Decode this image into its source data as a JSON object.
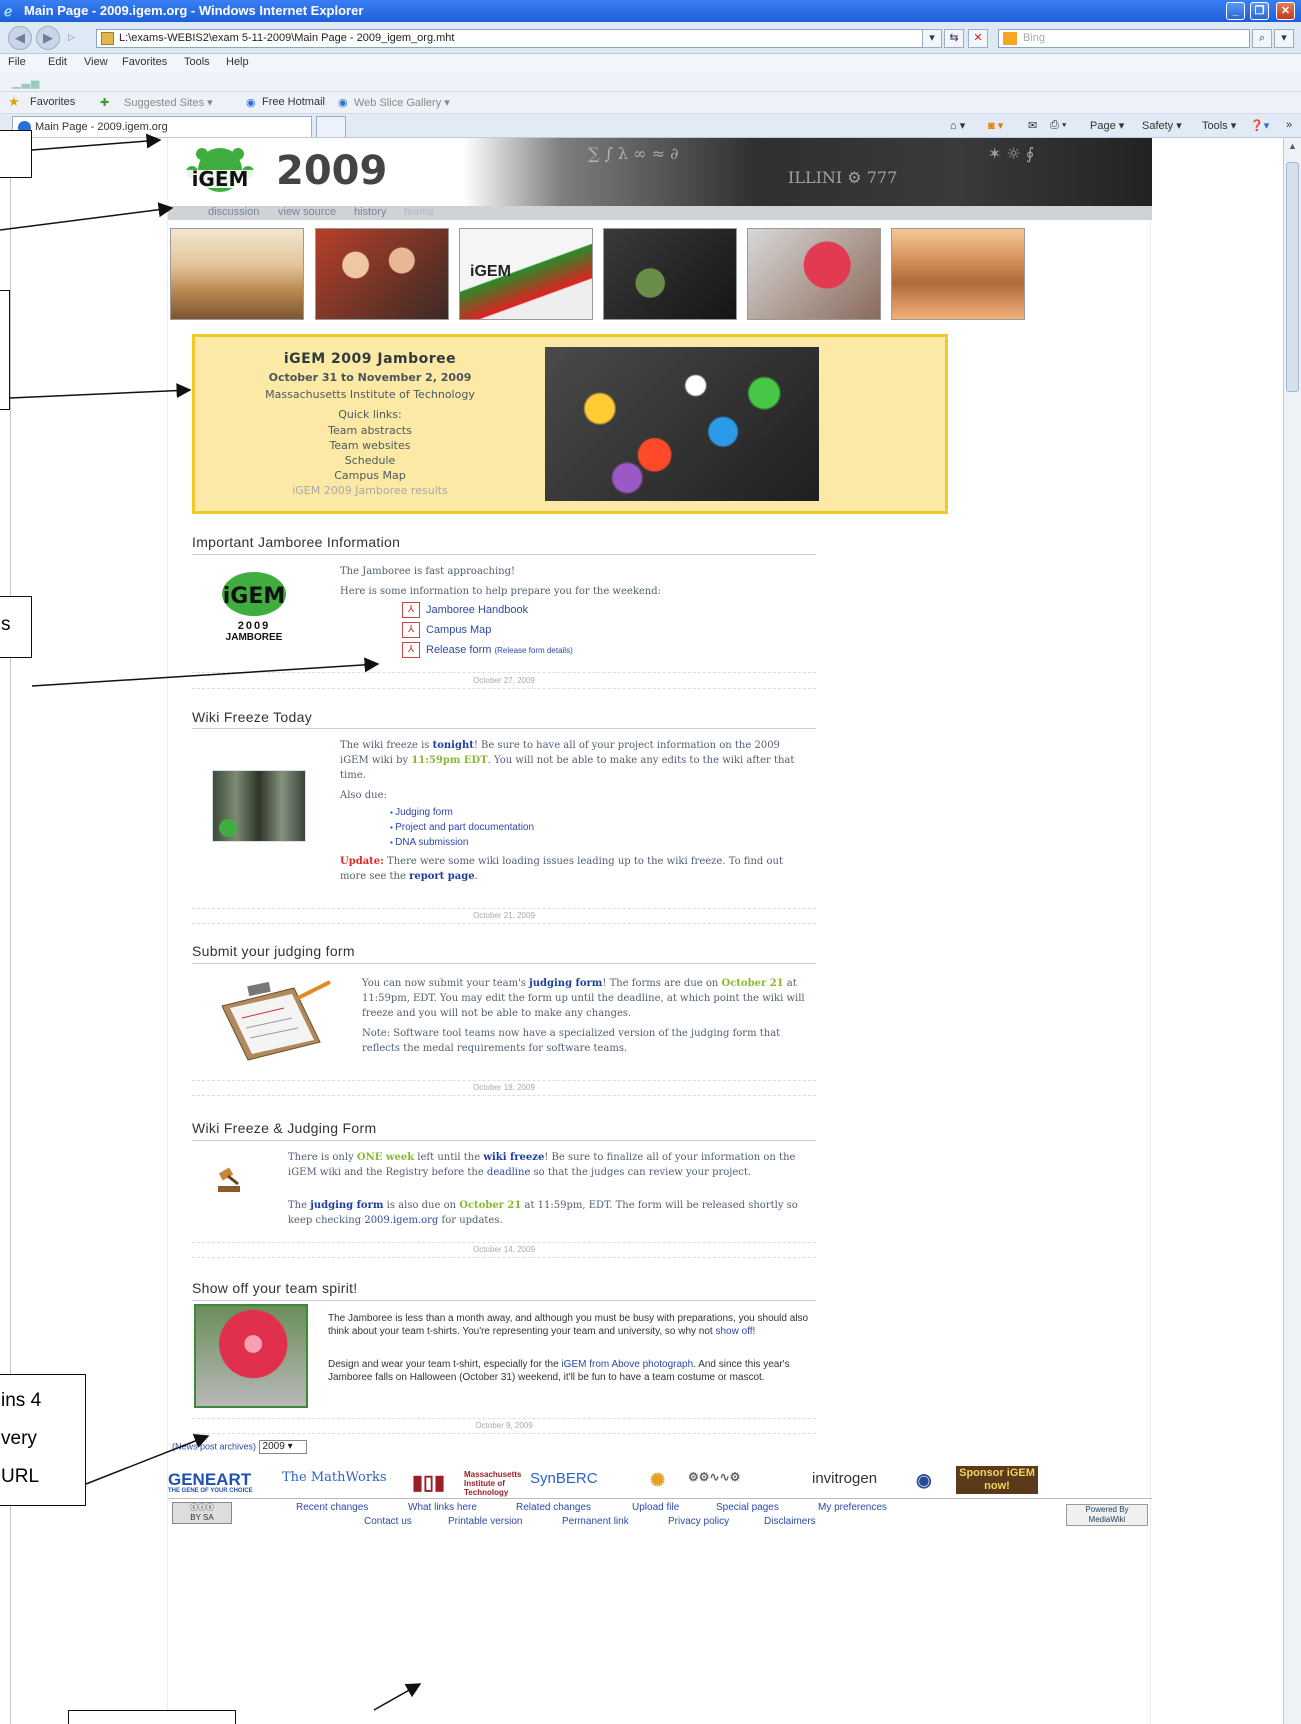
{
  "browser": {
    "window_title": "Main Page - 2009.igem.org - Windows Internet Explorer",
    "address": "L:\\exams-WEBIS2\\exam 5-11-2009\\Main Page - 2009_igem_org.mht",
    "search_placeholder": "Bing",
    "menu": [
      "File",
      "Edit",
      "View",
      "Favorites",
      "Tools",
      "Help"
    ],
    "favorites_label": "Favorites",
    "suggested_sites": "Suggested Sites ▾",
    "free_hotmail": "Free Hotmail",
    "web_slice_gallery": "Web Slice Gallery ▾",
    "tab_title": "Main Page - 2009.igem.org",
    "cmd_page": "Page ▾",
    "cmd_safety": "Safety ▾",
    "cmd_tools": "Tools ▾"
  },
  "header": {
    "logo_text": "iGEM",
    "year": "2009",
    "tabs": [
      "discussion",
      "view source",
      "history",
      "teams"
    ]
  },
  "jamboree": {
    "title": "iGEM 2009 Jamboree",
    "dates": "October 31 to November 2, 2009",
    "location": "Massachusetts Institute of Technology",
    "quick_links_label": "Quick links:",
    "quick_links": [
      "Team abstracts",
      "Team websites",
      "Schedule",
      "Campus Map"
    ],
    "results_link": "iGEM 2009 Jamboree results"
  },
  "news": {
    "important": {
      "title": "Important Jamboree Information",
      "logo_text": "iGEM",
      "logo_year": "2009",
      "logo_sub": "JAMBOREE",
      "line1": "The Jamboree is fast approaching!",
      "line2": "Here is some information to help prepare you for the weekend:",
      "pdfs": [
        "Jamboree Handbook",
        "Campus Map",
        "Release form"
      ],
      "release_details": "(Release form details)",
      "date": "October 27, 2009"
    },
    "freeze": {
      "title": "Wiki Freeze Today",
      "p1_a": "The wiki freeze is ",
      "p1_b": "tonight",
      "p1_c": "! Be sure to have all of your project information on the 2009 iGEM wiki by ",
      "p1_d": "11:59pm EDT",
      "p1_e": ". You will not be able to make any edits to the wiki after that time.",
      "also_due": "Also due:",
      "items": [
        "Judging form",
        "Project and part documentation",
        "DNA submission"
      ],
      "update_label": "Update:",
      "update_text": " There were some wiki loading issues leading up to the wiki freeze. To find out more see the ",
      "report_link": "report page",
      "update_end": ".",
      "date": "October 21, 2009"
    },
    "judging": {
      "title": "Submit your judging form",
      "p1_a": "You can now submit your team's ",
      "p1_b": "judging form",
      "p1_c": "! The forms are due on ",
      "p1_d": "October 21",
      "p1_e": " at 11:59pm, EDT. You may edit the form up until the deadline, at which point the wiki will freeze and you will not be able to make any changes.",
      "note": "Note: Software tool teams now have a specialized version of the judging form that reflects the medal requirements for software teams.",
      "date": "October 18, 2009"
    },
    "freeze_judging": {
      "title": "Wiki Freeze & Judging Form",
      "p1_a": "There is only ",
      "p1_b": "ONE week",
      "p1_c": " left until the ",
      "p1_d": "wiki freeze",
      "p1_e": "! Be sure to finalize all of your information on the iGEM wiki and the Registry before the ",
      "p1_f": "deadline",
      "p1_g": " so that the judges can review your project.",
      "p2_a": "The ",
      "p2_b": "judging form",
      "p2_c": " is also due on ",
      "p2_d": "October 21",
      "p2_e": " at 11:59pm, EDT. The form will be released shortly so keep checking ",
      "p2_f": "2009.igem.org",
      "p2_g": " for updates.",
      "date": "October 14, 2009"
    },
    "spirit": {
      "title": "Show off your team spirit!",
      "p1_a": "The Jamboree is less than a month away, and although you must be busy with preparations, you should also think about your team t-shirts. You're representing your team and university, so why not ",
      "p1_b": "show off!",
      "p2_a": "Design and wear your team t-shirt, especially for the ",
      "p2_b": "iGEM from Above photograph",
      "p2_c": ". And since this year's Jamboree falls on Halloween (October 31) weekend, it'll be fun to have a team costume or mascot.",
      "date": "October 9, 2009"
    }
  },
  "archives": {
    "label": "(News post archives)",
    "selected": "2009"
  },
  "sponsors": [
    "GENEART",
    "THE GENE OF YOUR CHOICE",
    "The MathWorks",
    "Massachusetts Institute of Technology",
    "SynBERC",
    "invitrogen",
    "Sponsor iGEM now!"
  ],
  "footer": {
    "row1": [
      "Recent changes",
      "What links here",
      "Related changes",
      "Upload file",
      "Special pages",
      "My preferences"
    ],
    "row2": [
      "Contact us",
      "Printable version",
      "Permanent link",
      "Privacy policy",
      "Disclaimers"
    ],
    "cc": "BY  SA",
    "mediawiki": "Powered By MediaWiki"
  },
  "annotations": {
    "left_partial_1": "ins 4",
    "left_partial_2": "very",
    "left_partial_3": "URL",
    "left_partial_s": "s"
  }
}
